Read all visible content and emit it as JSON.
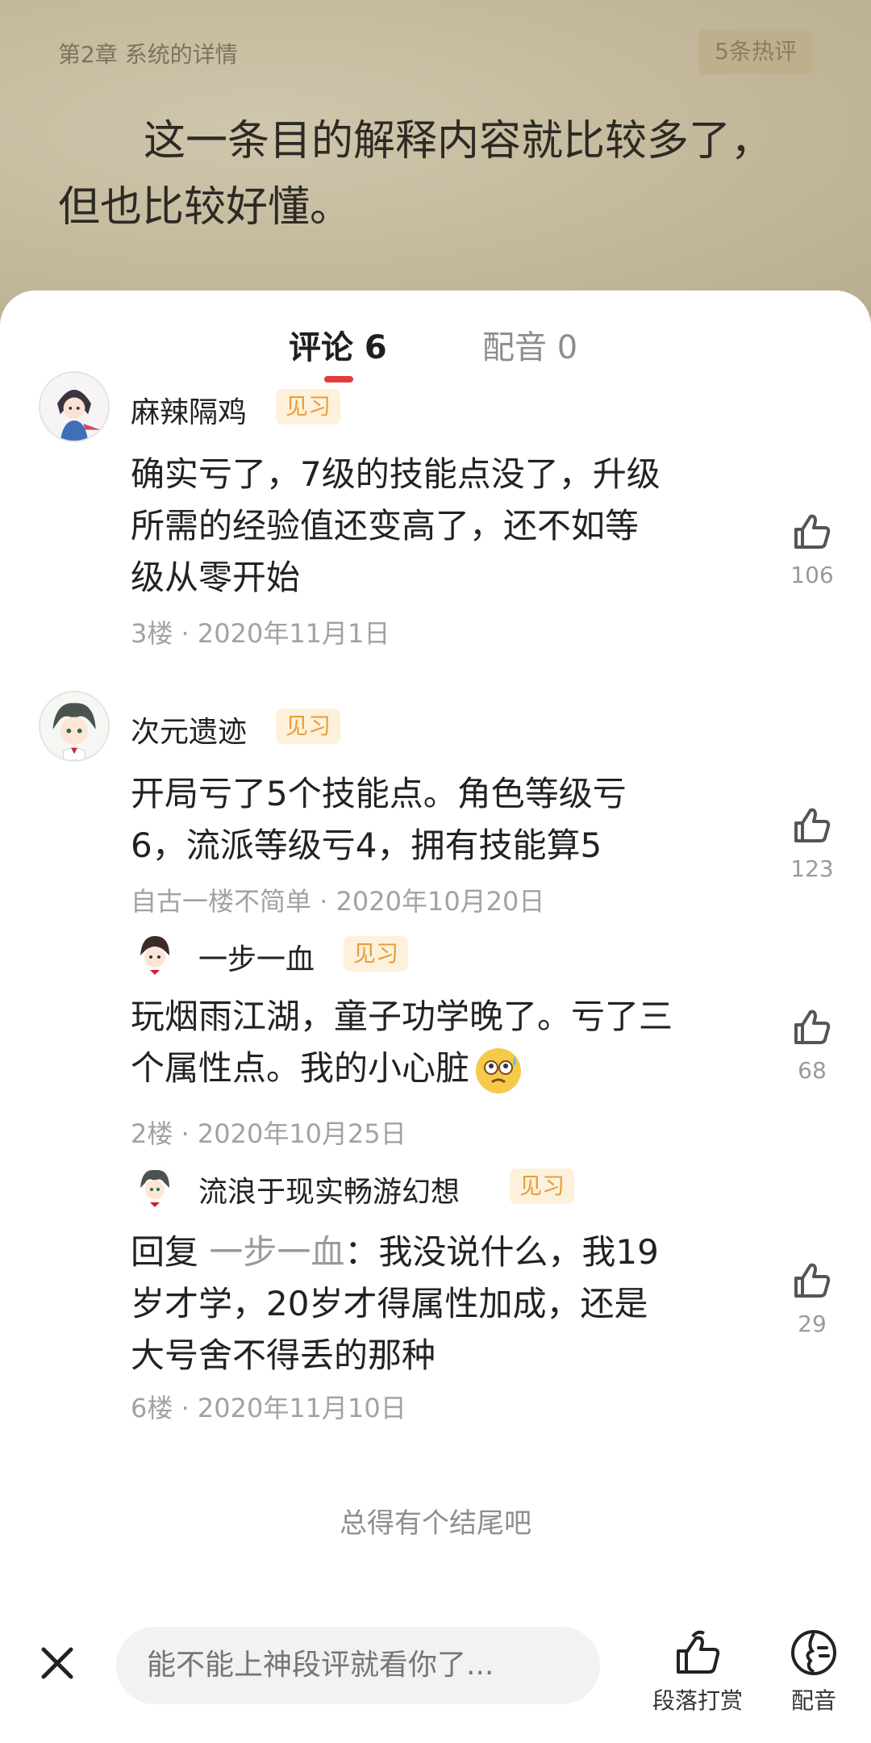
{
  "reader": {
    "chapter_title": "第2章 系统的详情",
    "hot_comments_label": "5条热评",
    "passage_line1": "这一条目的解释内容就比较多了，",
    "passage_line2": "但也比较好懂。"
  },
  "tabs": [
    {
      "label": "评论 6",
      "active": true
    },
    {
      "label": "配音 0",
      "active": false
    }
  ],
  "comments": [
    {
      "username": "麻辣隔鸡",
      "badge": "见习",
      "text_lines": [
        "确实亏了，7级的技能点没了，升级",
        "所需的经验值还变高了，还不如等",
        "级从零开始"
      ],
      "meta": "3楼 · 2020年11月1日",
      "likes": "106",
      "avatar": "girl-avatar-icon"
    },
    {
      "username": "次元遗迹",
      "badge": "见习",
      "text_lines": [
        "开局亏了5个技能点。角色等级亏",
        "6，流派等级亏4，拥有技能算5"
      ],
      "meta": "自古一楼不简单 · 2020年10月20日",
      "likes": "123",
      "avatar": "boy-avatar-icon",
      "replies": [
        {
          "username": "一步一血",
          "badge": "见习",
          "text_lines": [
            "玩烟雨江湖，童子功学晚了。亏了三",
            "个属性点。我的小心脏"
          ],
          "emoji": "worried-face-emoji-icon",
          "meta": "2楼 · 2020年10月25日",
          "likes": "68",
          "avatar": "chibi-avatar-icon"
        },
        {
          "username": "流浪于现实畅游幻想",
          "badge": "见习",
          "reply_prefix": "回复 ",
          "reply_to": "一步一血",
          "reply_colon": "：",
          "text_lines": [
            "我没说什么，我19",
            "岁才学，20岁才得属性加成，还是",
            "大号舍不得丢的那种"
          ],
          "meta": "6楼 · 2020年11月10日",
          "likes": "29",
          "avatar": "boy-avatar-icon"
        }
      ]
    }
  ],
  "footer_note": "总得有个结尾吧",
  "bottom_bar": {
    "input_placeholder": "能不能上神段评就看你了...",
    "reward_label": "段落打赏",
    "dub_label": "配音"
  },
  "colors": {
    "accent": "#e5393f",
    "badge_bg": "#fdf1dc",
    "badge_text": "#e79e3c"
  }
}
